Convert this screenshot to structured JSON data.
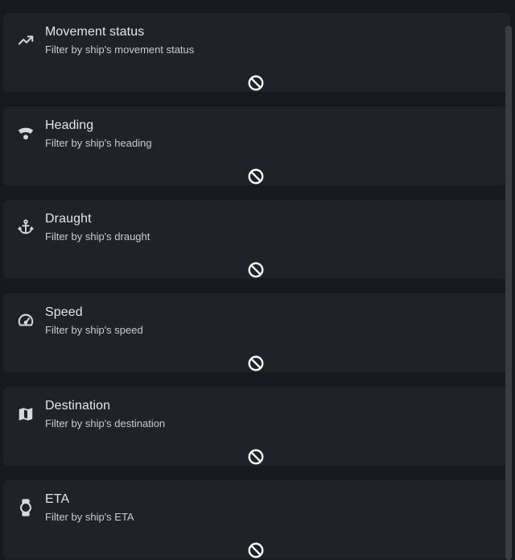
{
  "filters": [
    {
      "title": "Movement status",
      "subtitle": "Filter by ship's movement status",
      "icon": "trending-up-icon",
      "state": "disabled-icon"
    },
    {
      "title": "Heading",
      "subtitle": "Filter by ship's heading",
      "icon": "wifi-signal-icon",
      "state": "disabled-icon"
    },
    {
      "title": "Draught",
      "subtitle": "Filter by ship's draught",
      "icon": "anchor-icon",
      "state": "disabled-icon"
    },
    {
      "title": "Speed",
      "subtitle": "Filter by ship's speed",
      "icon": "speedometer-icon",
      "state": "disabled-icon"
    },
    {
      "title": "Destination",
      "subtitle": "Filter by ship's destination",
      "icon": "map-icon",
      "state": "disabled-icon"
    },
    {
      "title": "ETA",
      "subtitle": "Filter by ship's ETA",
      "icon": "watch-icon",
      "state": "disabled-icon"
    }
  ],
  "colors": {
    "background": "#16191d",
    "card": "#1f2227",
    "text": "#e4e6e9",
    "icon": "#d7d9dc"
  }
}
